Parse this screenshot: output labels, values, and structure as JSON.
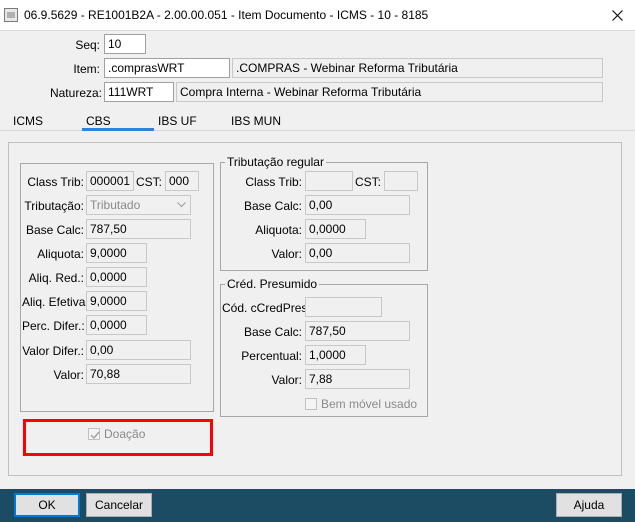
{
  "window": {
    "title": "06.9.5629 - RE1001B2A - 2.00.00.051 - Item Documento - ICMS - 10 - 8185"
  },
  "header": {
    "seq_label": "Seq:",
    "seq_value": "10",
    "item_label": "Item:",
    "item_code": ".comprasWRT",
    "item_desc": ".COMPRAS - Webinar Reforma Tributária",
    "natureza_label": "Natureza:",
    "natureza_code": "111WRT",
    "natureza_desc": "Compra Interna - Webinar Reforma Tributária"
  },
  "tabs": [
    {
      "label": "ICMS",
      "active": false
    },
    {
      "label": "CBS",
      "active": true
    },
    {
      "label": "IBS UF",
      "active": false
    },
    {
      "label": "IBS MUN",
      "active": false
    }
  ],
  "left": {
    "class_trib_label": "Class Trib:",
    "class_trib_value": "000001",
    "cst_label": "CST:",
    "cst_value": "000",
    "tributacao_label": "Tributação:",
    "tributacao_value": "Tributado",
    "base_calc_label": "Base Calc:",
    "base_calc_value": "787,50",
    "aliquota_label": "Aliquota:",
    "aliquota_value": "9,0000",
    "aliq_red_label": "Aliq. Red.:",
    "aliq_red_value": "0,0000",
    "aliq_efetiva_label": "Aliq. Efetiva:",
    "aliq_efetiva_value": "9,0000",
    "perc_difer_label": "Perc. Difer.:",
    "perc_difer_value": "0,0000",
    "valor_difer_label": "Valor Difer.:",
    "valor_difer_value": "0,00",
    "valor_label": "Valor:",
    "valor_value": "70,88",
    "doacao_label": "Doação",
    "doacao_checked": true
  },
  "regular": {
    "title": "Tributação regular",
    "class_trib_label": "Class Trib:",
    "class_trib_value": "",
    "cst_label": "CST:",
    "cst_value": "",
    "base_calc_label": "Base Calc:",
    "base_calc_value": "0,00",
    "aliquota_label": "Aliquota:",
    "aliquota_value": "0,0000",
    "valor_label": "Valor:",
    "valor_value": "0,00"
  },
  "presumido": {
    "title": "Créd. Presumido",
    "cod_label": "Cód. cCredPres:",
    "cod_value": "",
    "base_calc_label": "Base Calc:",
    "base_calc_value": "787,50",
    "percentual_label": "Percentual:",
    "percentual_value": "1,0000",
    "valor_label": "Valor:",
    "valor_value": "7,88",
    "bem_movel_label": "Bem móvel usado",
    "bem_movel_checked": false
  },
  "buttons": {
    "ok": "OK",
    "cancelar": "Cancelar",
    "ajuda": "Ajuda"
  },
  "colors": {
    "accent": "#2f84d9",
    "highlight": "#ff0000",
    "bottom_bar": "#1b4c63"
  }
}
